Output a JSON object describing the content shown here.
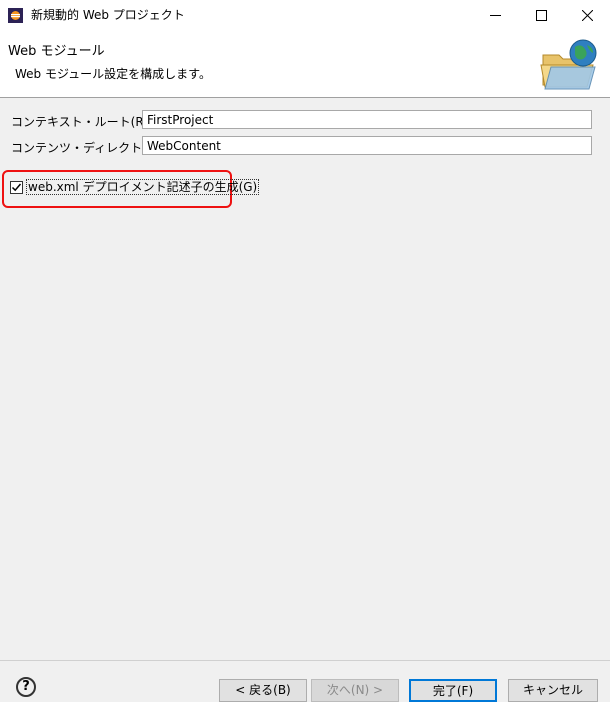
{
  "window": {
    "title": "新規動的 Web プロジェクト"
  },
  "header": {
    "title": "Web モジュール",
    "description": "Web モジュール設定を構成します。"
  },
  "form": {
    "context_root": {
      "label": "コンテキスト・ルート(R):",
      "value": "FirstProject"
    },
    "content_dir": {
      "label": "コンテンツ・ディレクトリー(D):",
      "value": "WebContent"
    },
    "generate_webxml": {
      "label": "web.xml デプロイメント記述子の生成(G)",
      "checked": true
    }
  },
  "footer": {
    "help_icon": "?",
    "back": "< 戻る(B)",
    "next": "次へ(N) >",
    "finish": "完了(F)",
    "cancel": "キャンセル"
  },
  "colors": {
    "highlight": "#e11111",
    "default_button_border": "#0078d7"
  }
}
